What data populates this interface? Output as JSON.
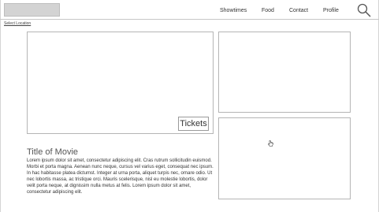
{
  "header": {
    "nav": [
      "Showtimes",
      "Food",
      "Contact",
      "Profile"
    ]
  },
  "location": {
    "label": "Select Location"
  },
  "hero": {
    "tickets_label": "Tickets"
  },
  "movie": {
    "title": "Title of Movie",
    "description": "Lorem ipsum dolor sit amet, consectetur adipiscing elit. Cras rutrum sollicitudin euismod. Morbi et porta magna. Aenean nunc neque, cursus vel varius eget, consequat nec ipsum. In hac habitasse platea dictumst. Integer at urna porta, aliquet turpis nec, ornare odio. Ut nec lobortis massa, ac tristique orci. Mauris scelerisque, nisl eu molestie lobortis, dolor velit porta neque, at dignissim nulla metus at felis. Lorem ipsum dolor sit amet, consectetur adipiscing elit."
  },
  "icons": {
    "search": "search-icon",
    "cursor": "pointer-cursor-icon"
  },
  "colors": {
    "logo_fill": "#d3d3d3",
    "border": "#b5b5b5",
    "text": "#333333"
  }
}
